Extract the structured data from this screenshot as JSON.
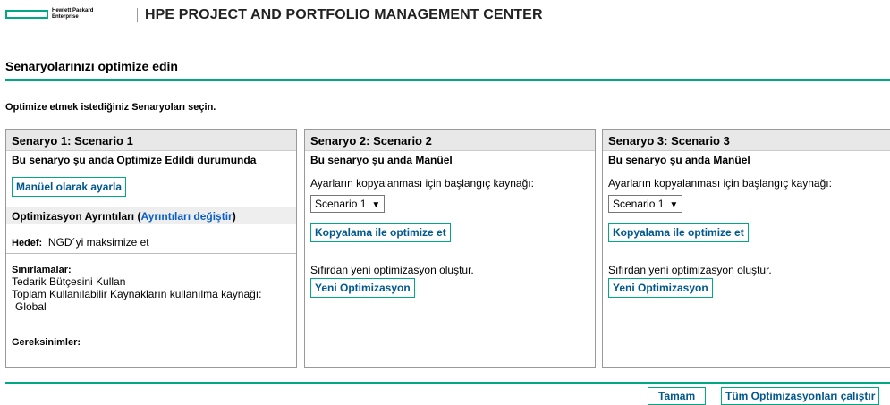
{
  "header": {
    "logo_text": "Hewlett Packard\nEnterprise",
    "title": "HPE PROJECT AND PORTFOLIO MANAGEMENT CENTER"
  },
  "page": {
    "title": "Senaryolarınızı optimize edin",
    "instruction": "Optimize etmek istediğiniz Senaryoları seçin."
  },
  "colors": {
    "accent": "#01a982",
    "link": "#0a5ec4",
    "button_text": "#00588e"
  },
  "scenario1": {
    "header": "Senaryo 1: Scenario 1",
    "status": "Bu senaryo şu anda Optimize Edildi durumunda",
    "manual_button": "Manüel olarak ayarla",
    "details_label": "Optimizasyon Ayrıntıları (",
    "details_link": "Ayrıntıları değiştir",
    "details_close": ")",
    "goal_label": "Hedef:",
    "goal_value": "NGD´yi maksimize et",
    "constraints_label": "Sınırlamalar:",
    "constraint_1": "Tedarik Bütçesini Kullan",
    "constraint_2": "Toplam Kullanılabilir Kaynakların kullanılma kaynağı:",
    "constraint_3": "Global",
    "requirements_label": "Gereksinimler:"
  },
  "scenario2": {
    "header": "Senaryo 2: Scenario 2",
    "status": "Bu senaryo şu anda Manüel",
    "copy_label": "Ayarların kopyalanması için başlangıç kaynağı:",
    "select_value": "Scenario 1",
    "copy_button": "Kopyalama ile optimize et",
    "new_label": "Sıfırdan yeni optimizasyon oluştur.",
    "new_button": "Yeni Optimizasyon"
  },
  "scenario3": {
    "header": "Senaryo 3: Scenario 3",
    "status": "Bu senaryo şu anda Manüel",
    "copy_label": "Ayarların kopyalanması için başlangıç kaynağı:",
    "select_value": "Scenario 1",
    "copy_button": "Kopyalama ile optimize et",
    "new_label": "Sıfırdan yeni optimizasyon oluştur.",
    "new_button": "Yeni Optimizasyon"
  },
  "footer": {
    "ok_button": "Tamam",
    "run_all_button": "Tüm Optimizasyonları çalıştır"
  },
  "icons": {
    "dropdown_arrow": "▼"
  }
}
